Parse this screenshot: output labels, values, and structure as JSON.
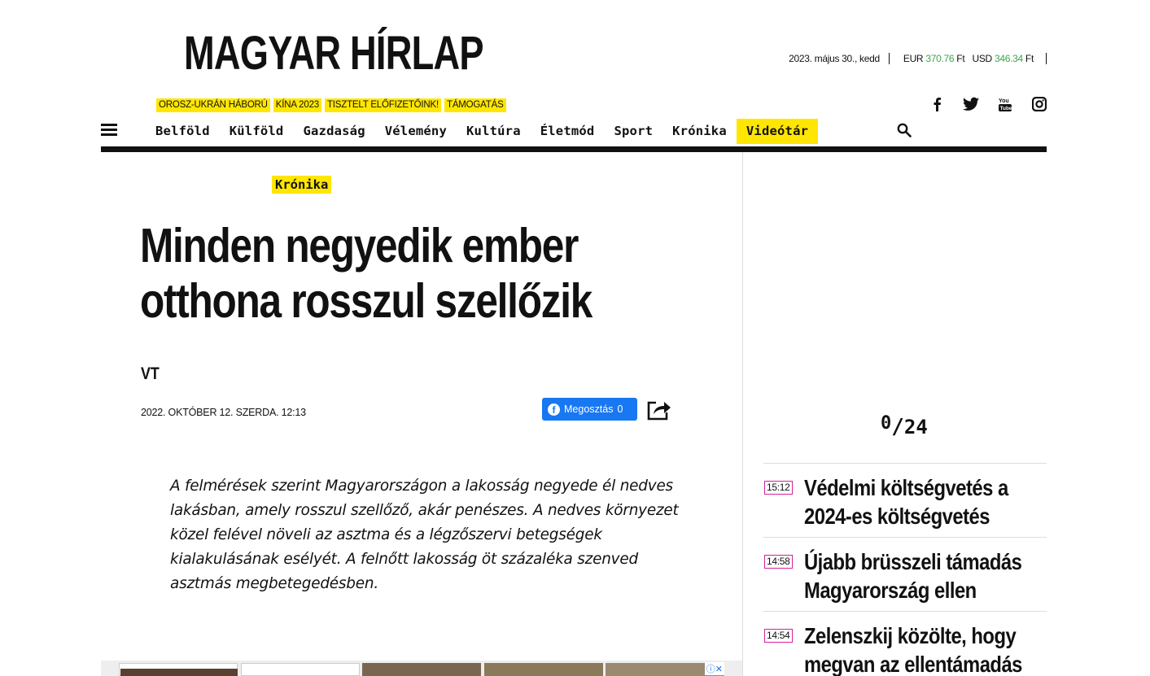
{
  "brand": {
    "logo_text": "MAGYAR HÍRLAP"
  },
  "top_info": {
    "date": "2023. május 30., kedd",
    "eur_label": "EUR",
    "eur_value": "370.76",
    "eur_unit": "Ft",
    "usd_label": "USD",
    "usd_value": "346.34",
    "usd_unit": "Ft"
  },
  "hot_tags": [
    "OROSZ-UKRÁN HÁBORÚ",
    "KÍNA 2023",
    "TISZTELT ELŐFIZETŐINK!",
    "TÁMOGATÁS"
  ],
  "social": [
    "facebook-icon",
    "twitter-icon",
    "youtube-icon",
    "instagram-icon"
  ],
  "nav": {
    "items": [
      "Belföld",
      "Külföld",
      "Gazdaság",
      "Vélemény",
      "Kultúra",
      "Életmód",
      "Sport",
      "Krónika",
      "Videótár"
    ],
    "highlight_color": "#ffe600"
  },
  "article": {
    "category": "Krónika",
    "title": "Minden negyedik ember otthona rosszul szellőzik",
    "author": "VT",
    "published": "2022. OKTÓBER 12. SZERDA. 12:13",
    "share_label": "Megosztás",
    "share_count": "0",
    "lead": "A felmérések szerint Magyarországon a lakosság negyede él nedves lakásban, amely rosszul szellőző, akár penészes. A nedves környezet közel felével növeli az asztma és a légzőszervi betegségek kialakulásának esélyét. A felnőtt lakosság öt százaléka szenved asztmás megbetegedésben."
  },
  "sidebar": {
    "counter_top": "0",
    "counter_bottom": "24",
    "news": [
      {
        "time": "15:12",
        "title": "Védelmi költségvetés a 2024-es költségvetés"
      },
      {
        "time": "14:58",
        "title": "Újabb brüsszeli támadás Magyarország ellen"
      },
      {
        "time": "14:54",
        "title": "Zelenszkij közölte, hogy megvan az ellentámadás"
      }
    ],
    "time_border_color": "#d6209a"
  }
}
